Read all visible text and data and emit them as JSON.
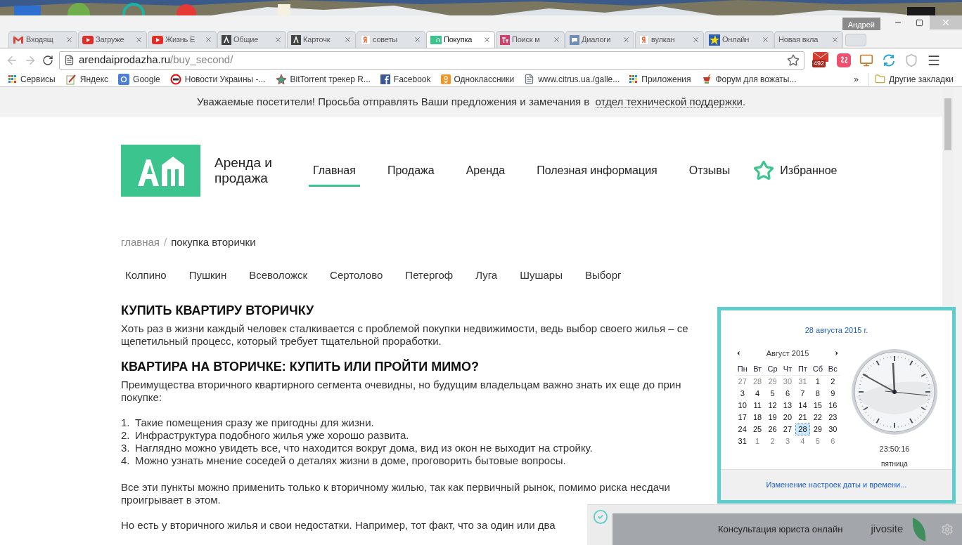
{
  "browser": {
    "profile": "Андрей",
    "tabs": [
      {
        "kind": "mail",
        "title": "Входящ",
        "selected": false
      },
      {
        "kind": "play",
        "title": "Загруже",
        "selected": false
      },
      {
        "kind": "play",
        "title": "Жизнь Е",
        "selected": false
      },
      {
        "kind": "dark",
        "title": "Общие",
        "selected": false
      },
      {
        "kind": "dark",
        "title": "Карточк",
        "selected": false
      },
      {
        "kind": "yandex",
        "title": "советы",
        "selected": false
      },
      {
        "kind": "site",
        "title": "Покупка",
        "selected": true
      },
      {
        "kind": "pink",
        "title": "Поиск м",
        "selected": false
      },
      {
        "kind": "chat",
        "title": "Диалоги",
        "selected": false
      },
      {
        "kind": "yandex",
        "title": "вулкан",
        "selected": false
      },
      {
        "kind": "star",
        "title": "Онлайн",
        "selected": false
      },
      {
        "kind": "none",
        "title": "Новая вкла",
        "selected": false
      }
    ],
    "address": {
      "host": "arendaiprodazha.ru",
      "path": "/buy_second/"
    },
    "mail_badge": "492",
    "bookmarks": [
      {
        "kind": "grid",
        "label": "Сервисы"
      },
      {
        "kind": "pen",
        "label": "Яндекс"
      },
      {
        "kind": "google",
        "label": "Google"
      },
      {
        "kind": "ring",
        "label": "Новости Украины -..."
      },
      {
        "kind": "burst",
        "label": "BitTorrent трекер R..."
      },
      {
        "kind": "facebook",
        "label": "Facebook"
      },
      {
        "kind": "ok",
        "label": "Одноклассники"
      },
      {
        "kind": "page",
        "label": "www.citrus.ua./galle..."
      },
      {
        "kind": "grid",
        "label": "Приложения"
      },
      {
        "kind": "cup",
        "label": "Форум для вожаты..."
      }
    ],
    "bookmarks_more": "»",
    "other_bookmarks": "Другие закладки"
  },
  "page": {
    "notice": {
      "before": "Уважаемые посетители! Просьба отправлять Ваши предложения и замечания в",
      "link": "отдел технической поддержки",
      "after": "."
    },
    "brand": "Аренда и продажа",
    "nav": [
      {
        "label": "Главная",
        "selected": true
      },
      {
        "label": "Продажа",
        "selected": false
      },
      {
        "label": "Аренда",
        "selected": false
      },
      {
        "label": "Полезная информация",
        "selected": false
      },
      {
        "label": "Отзывы",
        "selected": false
      }
    ],
    "favorites": "Избранное",
    "breadcrumb": {
      "home": "главная",
      "separator": "/",
      "current": "покупка вторички"
    },
    "cities": [
      "Колпино",
      "Пушкин",
      "Всеволожск",
      "Сертолово",
      "Петергоф",
      "Луга",
      "Шушары",
      "Выборг"
    ],
    "article": [
      {
        "kind": "h",
        "text": "КУПИТЬ КВАРТИРУ ВТОРИЧКУ"
      },
      {
        "kind": "p",
        "lines": [
          "Хоть раз в жизни каждый человек сталкивается с проблемой покупки недвижимости, ведь выбор своего жилья – се",
          "щепетильный процесс, который требует тщательной проработки."
        ]
      },
      {
        "kind": "h",
        "text": "КВАРТИРА НА ВТОРИЧКЕ: КУПИТЬ ИЛИ ПРОЙТИ МИМО?"
      },
      {
        "kind": "p",
        "lines": [
          "Преимущества вторичного квартирного сегмента очевидны, но будущим владельцам важно знать их еще до прин",
          "покупке:"
        ]
      },
      {
        "kind": "ol",
        "items": [
          {
            "num": "1.",
            "text": "Такие помещения сразу же пригодны для жизни."
          },
          {
            "num": "2.",
            "text": "Инфраструктура подобного жилья уже хорошо развита."
          },
          {
            "num": "3.",
            "text": "Наглядно можно увидеть все, что находится вокруг дома, вид из окон не выходит на стройку."
          },
          {
            "num": "4.",
            "text": "Можно узнать мнение соседей о деталях жизни в доме, проговорить бытовые вопросы."
          }
        ]
      },
      {
        "kind": "p",
        "lines": [
          "Все эти пункты можно применить только к вторичному жилью, так как первичный рынок, помимо риска несдачи",
          "проигрывает в этом."
        ]
      },
      {
        "kind": "p",
        "lines": [
          "Но есть у вторичного жилья и свои недостатки. Например, тот факт, что за один или два"
        ]
      }
    ]
  },
  "calendar_popup": {
    "date": "28 августа 2015 г.",
    "month": "Август 2015",
    "weekdays": [
      "Пн",
      "Вт",
      "Ср",
      "Чт",
      "Пт",
      "Сб",
      "Вс"
    ],
    "weeks": [
      [
        {
          "d": "27",
          "muted": true,
          "selected": false
        },
        {
          "d": "28",
          "muted": true,
          "selected": false
        },
        {
          "d": "29",
          "muted": true,
          "selected": false
        },
        {
          "d": "30",
          "muted": true,
          "selected": false
        },
        {
          "d": "31",
          "muted": true,
          "selected": false
        },
        {
          "d": "1",
          "muted": false,
          "selected": false
        },
        {
          "d": "2",
          "muted": false,
          "selected": false
        }
      ],
      [
        {
          "d": "3",
          "muted": false,
          "selected": false
        },
        {
          "d": "4",
          "muted": false,
          "selected": false
        },
        {
          "d": "5",
          "muted": false,
          "selected": false
        },
        {
          "d": "6",
          "muted": false,
          "selected": false
        },
        {
          "d": "7",
          "muted": false,
          "selected": false
        },
        {
          "d": "8",
          "muted": false,
          "selected": false
        },
        {
          "d": "9",
          "muted": false,
          "selected": false
        }
      ],
      [
        {
          "d": "10",
          "muted": false,
          "selected": false
        },
        {
          "d": "11",
          "muted": false,
          "selected": false
        },
        {
          "d": "12",
          "muted": false,
          "selected": false
        },
        {
          "d": "13",
          "muted": false,
          "selected": false
        },
        {
          "d": "14",
          "muted": false,
          "selected": false
        },
        {
          "d": "15",
          "muted": false,
          "selected": false
        },
        {
          "d": "16",
          "muted": false,
          "selected": false
        }
      ],
      [
        {
          "d": "17",
          "muted": false,
          "selected": false
        },
        {
          "d": "18",
          "muted": false,
          "selected": false
        },
        {
          "d": "19",
          "muted": false,
          "selected": false
        },
        {
          "d": "20",
          "muted": false,
          "selected": false
        },
        {
          "d": "21",
          "muted": false,
          "selected": false
        },
        {
          "d": "22",
          "muted": false,
          "selected": false
        },
        {
          "d": "23",
          "muted": false,
          "selected": false
        }
      ],
      [
        {
          "d": "24",
          "muted": false,
          "selected": false
        },
        {
          "d": "25",
          "muted": false,
          "selected": false
        },
        {
          "d": "26",
          "muted": false,
          "selected": false
        },
        {
          "d": "27",
          "muted": false,
          "selected": false
        },
        {
          "d": "28",
          "muted": false,
          "selected": true
        },
        {
          "d": "29",
          "muted": false,
          "selected": false
        },
        {
          "d": "30",
          "muted": false,
          "selected": false
        }
      ],
      [
        {
          "d": "31",
          "muted": false,
          "selected": false
        },
        {
          "d": "1",
          "muted": true,
          "selected": false
        },
        {
          "d": "2",
          "muted": true,
          "selected": false
        },
        {
          "d": "3",
          "muted": true,
          "selected": false
        },
        {
          "d": "4",
          "muted": true,
          "selected": false
        },
        {
          "d": "5",
          "muted": true,
          "selected": false
        },
        {
          "d": "6",
          "muted": true,
          "selected": false
        }
      ]
    ],
    "time": "23:50:16",
    "weekday": "пятница",
    "settings_link": "Изменение настроек даты и времени..."
  },
  "chat_widget": {
    "title": "Консультация юриста онлайн",
    "brand": "jivosite"
  }
}
